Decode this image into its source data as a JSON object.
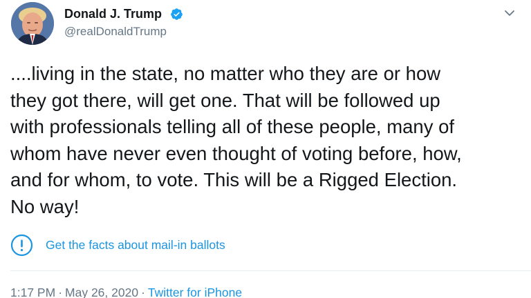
{
  "author": {
    "display_name": "Donald J. Trump",
    "handle": "@realDonaldTrump",
    "verified": true,
    "avatar_icon": "profile-photo"
  },
  "tweet": {
    "text": "....living in the state, no matter who they are or how\nthey got there, will get one. That will be followed up\nwith professionals telling all of these people, many of\nwhom have never even thought of voting before, how,\nand for whom, to vote. This will be a Rigged Election.\nNo way!"
  },
  "notice": {
    "icon": "exclamation-circle-icon",
    "link_text": "Get the facts about mail-in ballots"
  },
  "meta": {
    "time": "1:17 PM",
    "separator": "·",
    "date": "May 26, 2020",
    "source": "Twitter for iPhone"
  },
  "menu": {
    "icon": "chevron-down-icon"
  },
  "colors": {
    "text": "#14171a",
    "secondary": "#657786",
    "link": "#1b95e0",
    "verified_badge": "#1da1f2",
    "divider": "#e6ecf0"
  }
}
